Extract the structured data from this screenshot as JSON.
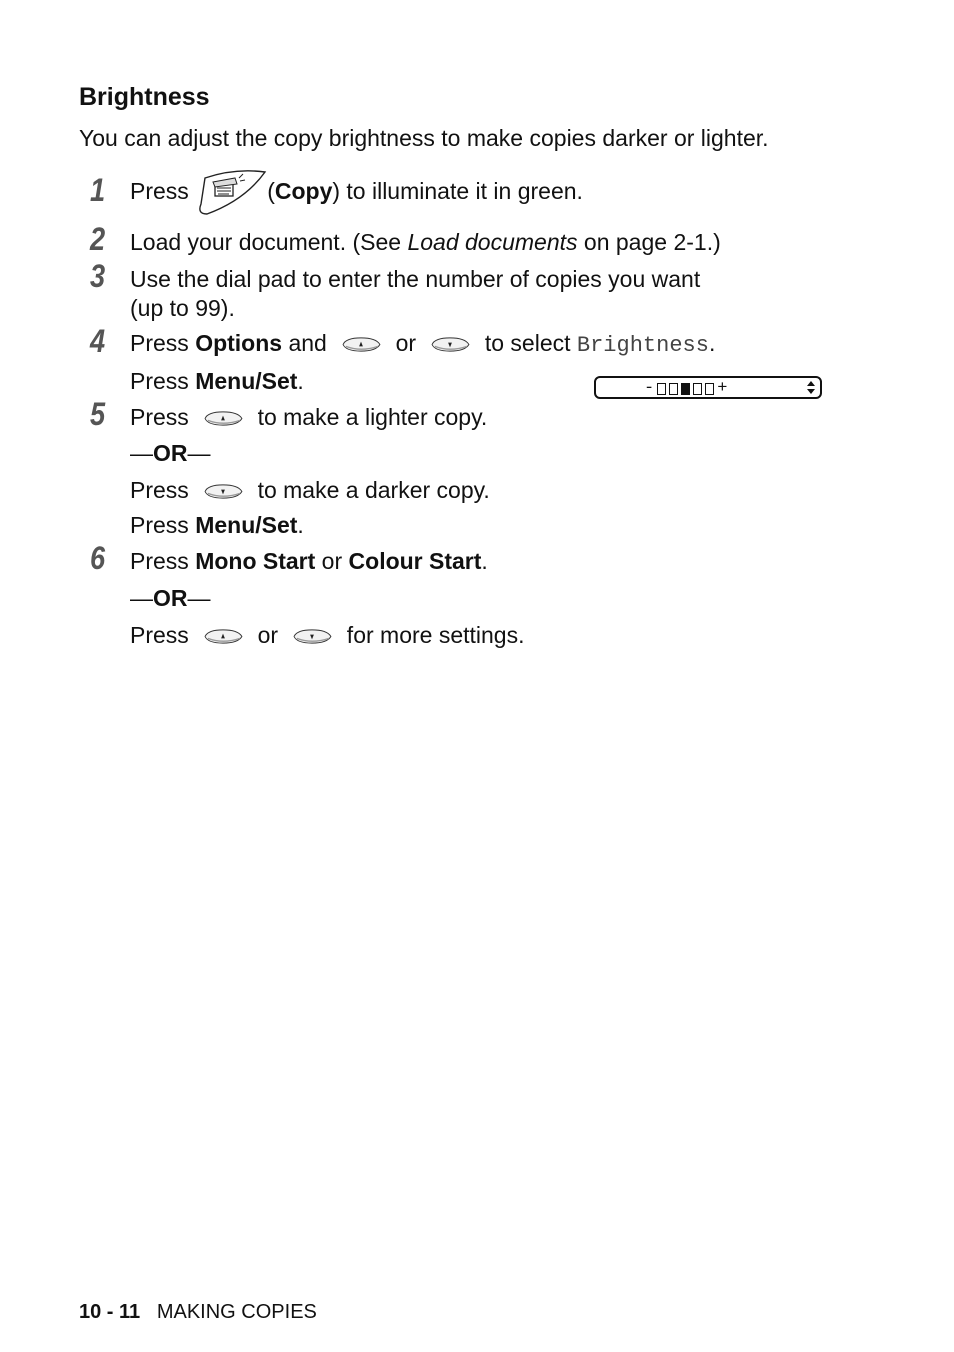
{
  "heading": "Brightness",
  "intro": "You can adjust the copy brightness to make copies darker or lighter.",
  "steps": {
    "s1": {
      "num": "1",
      "pre": "Press ",
      "key": "Copy",
      "post": ") to illuminate it in green.",
      "open": "("
    },
    "s2": {
      "num": "2",
      "pre": "Load your document. (See ",
      "link": "Load documents",
      "post": " on page 2-1.)"
    },
    "s3": {
      "num": "3",
      "line1": "Use the dial pad to enter the number of copies you want",
      "line2": "(up to 99)."
    },
    "s4": {
      "num": "4",
      "pre": "Press ",
      "key": "Options",
      "and": " and ",
      "or": " or ",
      "select": " to select ",
      "mono": "Brightness",
      "dot": ".",
      "line2_pre": "Press ",
      "line2_key": "Menu/Set",
      "line2_dot": "."
    },
    "s5": {
      "num": "5",
      "pre": "Press ",
      "post": " to make a lighter copy.",
      "or_sep": "OR",
      "line3_pre": "Press ",
      "line3_post": " to make a darker copy.",
      "line4_pre": "Press ",
      "line4_key": "Menu/Set",
      "line4_dot": "."
    },
    "s6": {
      "num": "6",
      "pre": "Press ",
      "key1": "Mono Start",
      "or": " or ",
      "key2": "Colour Start",
      "dot": ".",
      "or_sep": "OR",
      "line3_pre": "Press ",
      "line3_or": " or ",
      "line3_post": " for more settings."
    }
  },
  "lcd": {
    "minus": "-",
    "plus": "+",
    "level": 3,
    "levels": 5
  },
  "footer": {
    "page": "10 - 11",
    "section": "MAKING COPIES"
  },
  "icons": {
    "copy": "copy-key-icon",
    "up": "up-arrow-key-icon",
    "down": "down-arrow-key-icon"
  }
}
